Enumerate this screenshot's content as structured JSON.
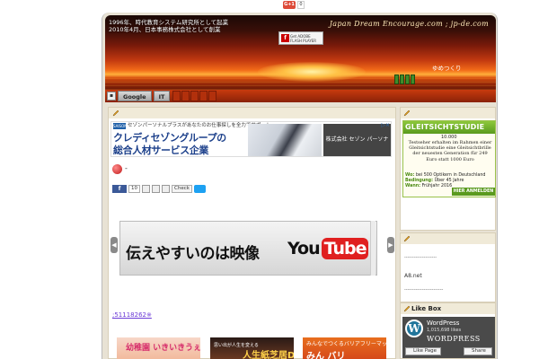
{
  "topbar": {
    "gplus_label": "G+1",
    "gplus_count": "0"
  },
  "header": {
    "slogan_line1": "1996年、時代教育システム研究所として起業",
    "slogan_line2": "2010年4月、日本事務株式会社として創業",
    "site_title": "Japan Dream Encourage.com ; jp-de.com",
    "flash_badge": "Get ADOBE FLASH PLAYER",
    "flash_icon": "f",
    "tagline": "ゆめつくり"
  },
  "nav": {
    "home_icon": "▪",
    "items": [
      {
        "label": "Google"
      },
      {
        "label": "IT"
      }
    ]
  },
  "main": {
    "ad": {
      "badge": "SAISON",
      "top_text": "セゾンパーソナルプラスがあなたのお仕事探しを全力でサポート",
      "headline_line1": "クレディセゾングループの",
      "headline_line2": "総合人材サービス企業",
      "logo_text": "株式会社 セゾン パーソナルプラス",
      "close_icon": "▷×"
    },
    "row_dash": "-",
    "share": {
      "fb": "f",
      "fb_count": "10",
      "check": "Check"
    },
    "video": {
      "text": "伝えやすいのは映像",
      "yt_you": "You",
      "yt_tube": "Tube",
      "left_arrow": "◀",
      "right_arrow": "▶"
    },
    "code_link": ";51118262※",
    "thumbs": {
      "t1": "幼稚園 いきいきうぇぶ",
      "t2_small": "思い出が人生を変える",
      "t2_big": "人生紙芝居DVD",
      "t3_small": "みんなでつくるバリアフリーマップ",
      "t3_big": "みん バリ"
    }
  },
  "sidebar": {
    "ad": {
      "title": "GLEITSICHTSTUDIE",
      "number": "10.000",
      "body": "Testseher erhalten im Rahmen einer Gleitsichtstudie eine Gleitsichtbrille der neuesten Generation für 249 Euro statt 1000 Euro",
      "wo_label": "Wo:",
      "wo_text": "bei 500 Optikern in Deutschland",
      "bed_label": "Bedingung:",
      "bed_text": "Über 45 Jahre",
      "wann_label": "Wann:",
      "wann_text": "Frühjahr 2016",
      "button": "HIER ANMELDEN"
    },
    "widget2": {
      "dash1": "--------------------",
      "a8": "A8.net",
      "dash2": "------------------------"
    },
    "likebox": {
      "title": "Like Box",
      "name": "WordPress",
      "likes": "1,015,698 likes",
      "wordmark": "WORDPRESS",
      "logo": "W",
      "like_button": "Like Page",
      "share_button": "Share"
    }
  }
}
